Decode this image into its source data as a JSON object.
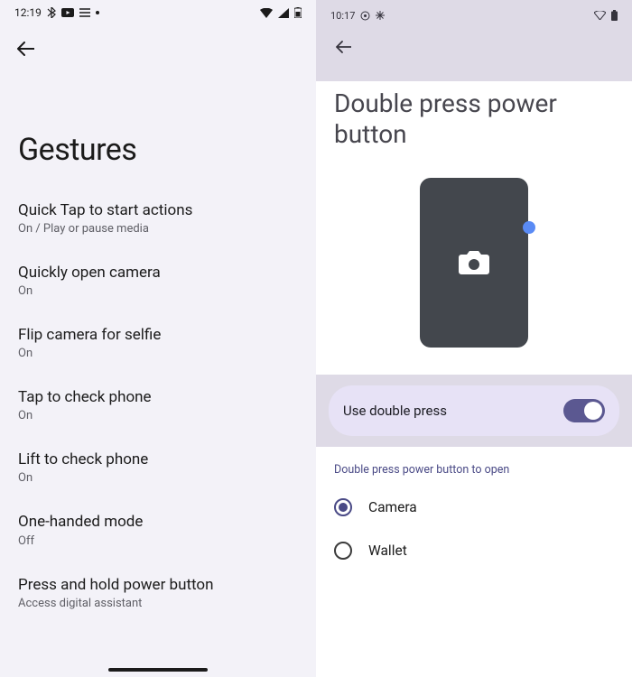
{
  "left": {
    "status": {
      "time": "12:19"
    },
    "title": "Gestures",
    "items": [
      {
        "label": "Quick Tap to start actions",
        "sub": "On / Play or pause media"
      },
      {
        "label": "Quickly open camera",
        "sub": "On"
      },
      {
        "label": "Flip camera for selfie",
        "sub": "On"
      },
      {
        "label": "Tap to check phone",
        "sub": "On"
      },
      {
        "label": "Lift to check phone",
        "sub": "On"
      },
      {
        "label": "One-handed mode",
        "sub": "Off"
      },
      {
        "label": "Press and hold power button",
        "sub": "Access digital assistant"
      }
    ]
  },
  "right": {
    "status": {
      "time": "10:17"
    },
    "title": "Double press power button",
    "toggle": {
      "label": "Use double press",
      "on": true
    },
    "radio_header": "Double press power button to open",
    "options": [
      {
        "label": "Camera",
        "checked": true
      },
      {
        "label": "Wallet",
        "checked": false
      }
    ]
  }
}
